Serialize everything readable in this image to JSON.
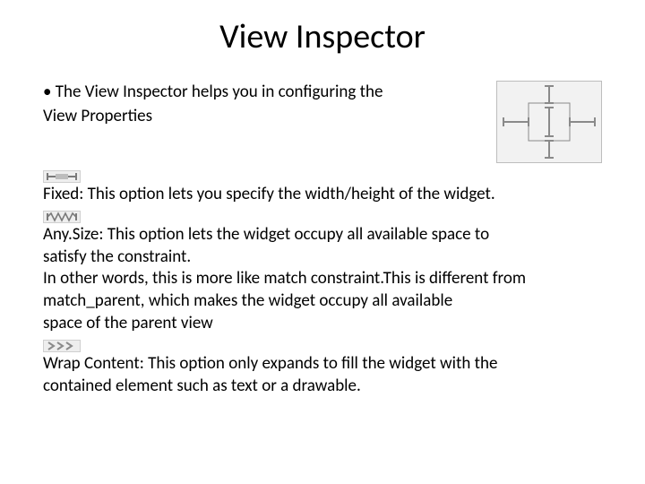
{
  "title": "View Inspector",
  "intro_bullet": "The View Inspector helps you in configuring the",
  "intro_line2": "View Properties",
  "fixed_text": "Fixed: This option lets you specify the width/height of the widget.",
  "anysize_l1": "Any.Size: This option lets the widget occupy all available space to",
  "anysize_l2": "satisfy the constraint.",
  "anysize_l3": "In other words, this is more like match constraint.This is different from",
  "anysize_l4": "match_parent, which makes the widget occupy all available",
  "anysize_l5": "space of the parent view",
  "wrap_l1": "Wrap Content: This option only expands to fill the widget with the",
  "wrap_l2": "contained element such as text or a drawable."
}
